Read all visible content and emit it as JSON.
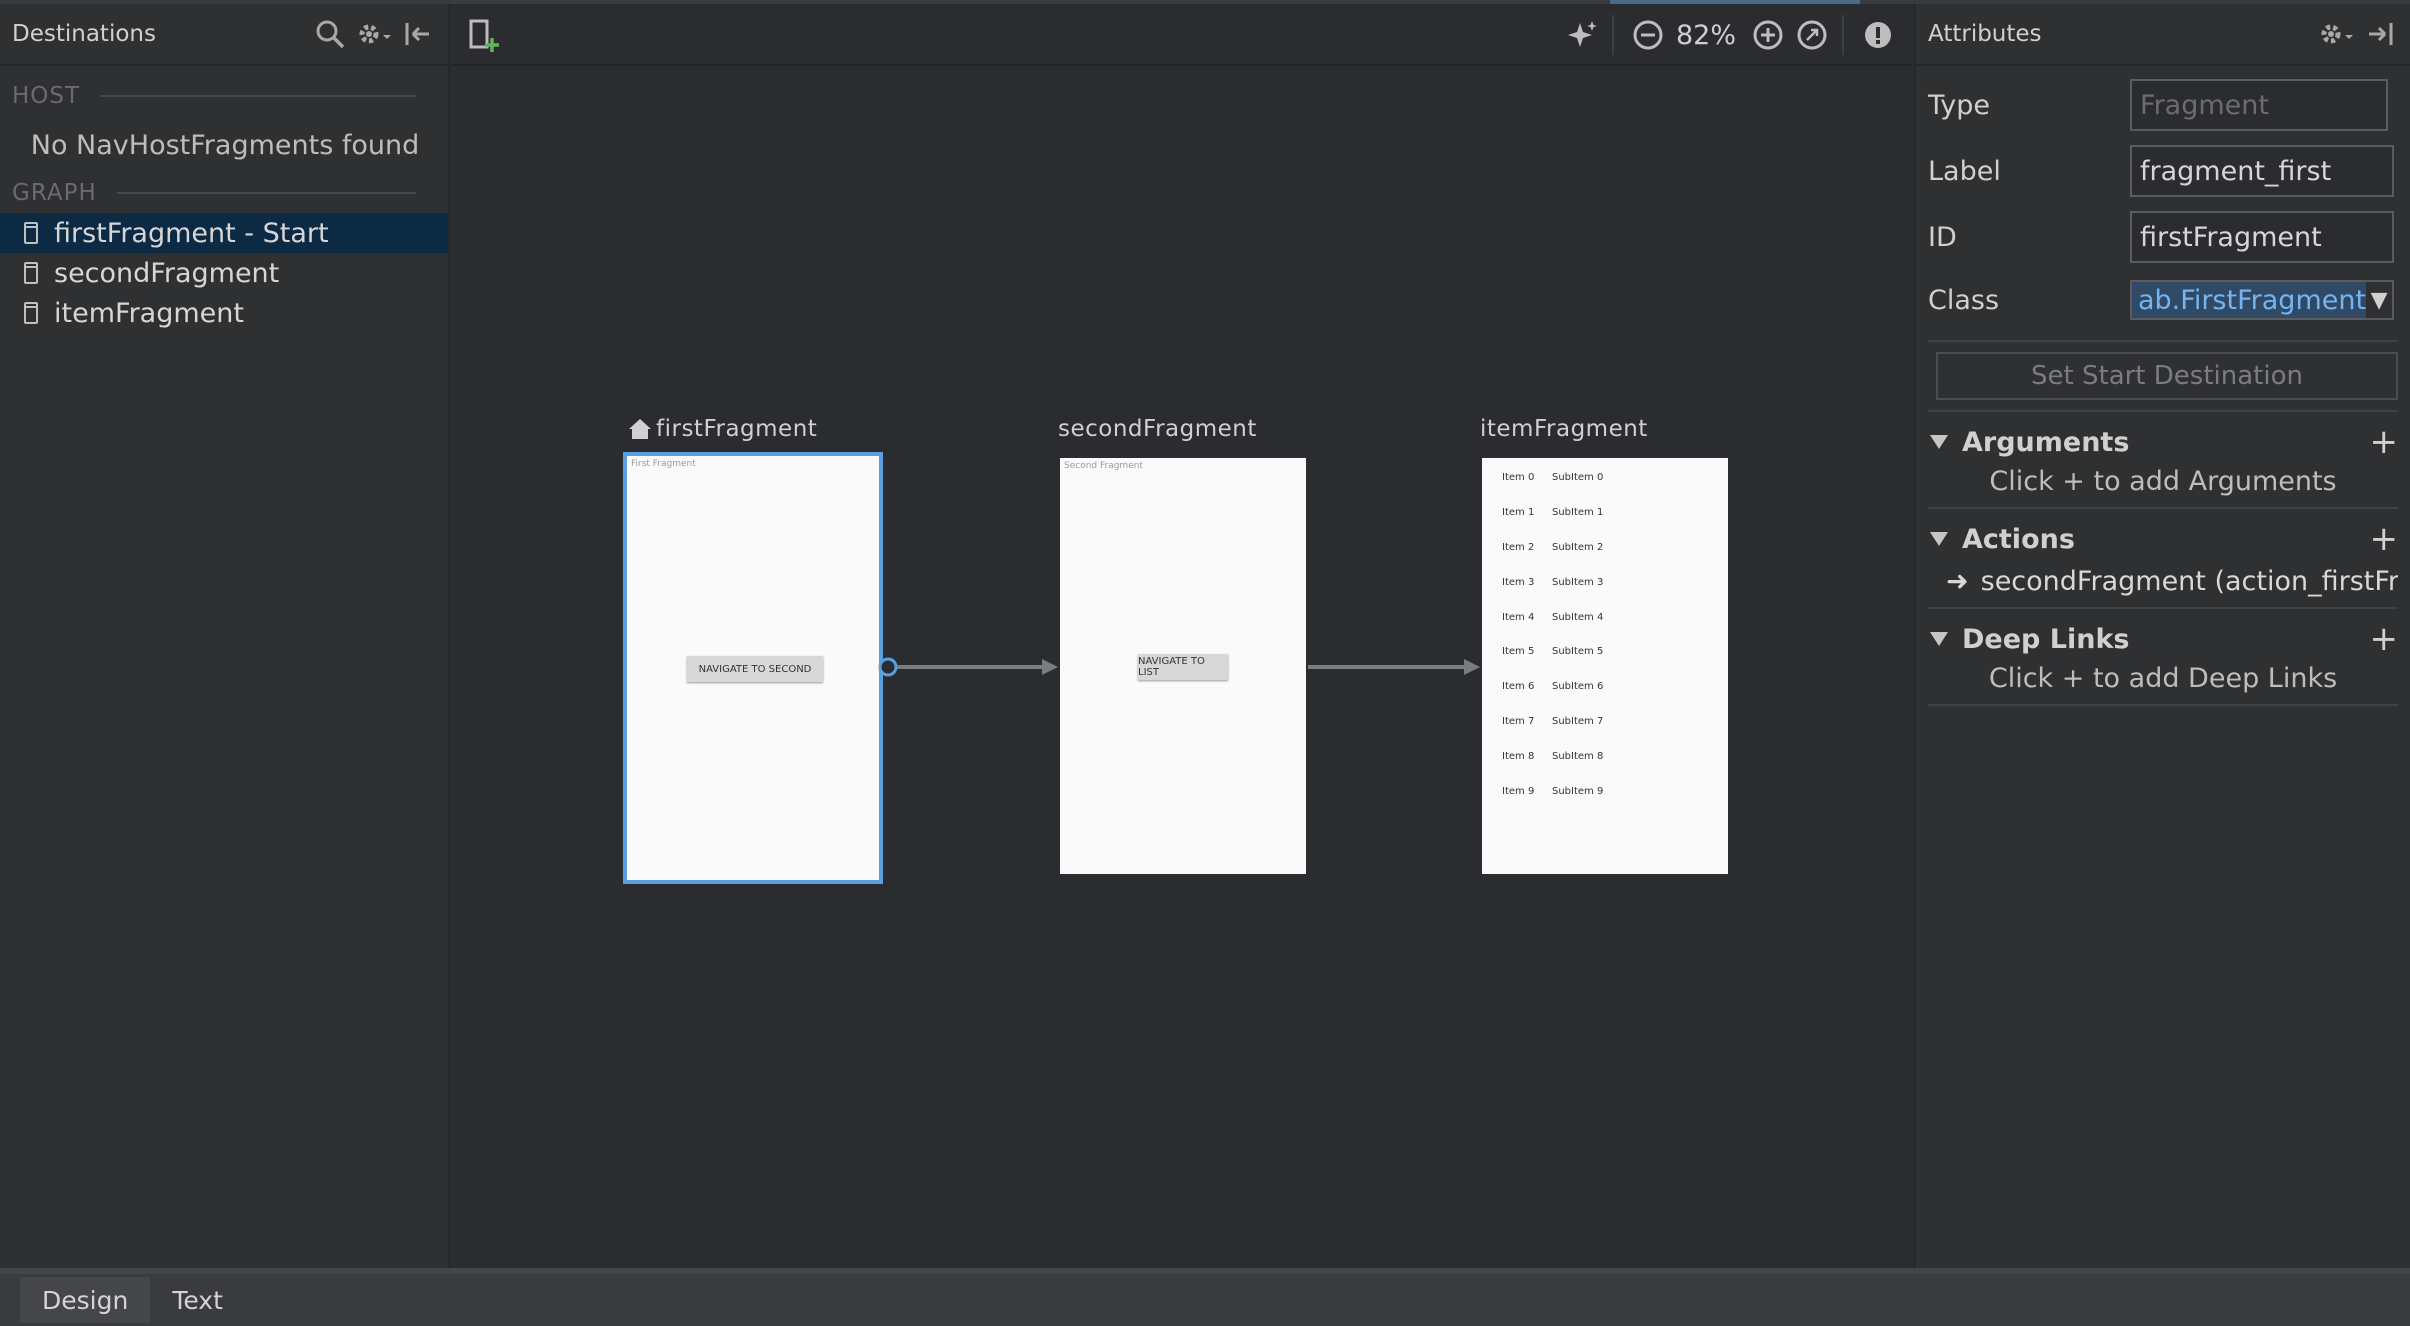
{
  "destinations_panel": {
    "title": "Destinations",
    "host_section": "HOST",
    "host_message": "No NavHostFragments found",
    "graph_section": "GRAPH",
    "items": [
      {
        "label": "firstFragment - Start",
        "selected": true
      },
      {
        "label": "secondFragment",
        "selected": false
      },
      {
        "label": "itemFragment",
        "selected": false
      }
    ]
  },
  "toolbar": {
    "zoom": "82%"
  },
  "graph": {
    "first": {
      "label": "firstFragment",
      "inner_title": "First Fragment",
      "button": "NAVIGATE TO SECOND"
    },
    "second": {
      "label": "secondFragment",
      "inner_title": "Second Fragment",
      "button": "NAVIGATE TO LIST"
    },
    "item": {
      "label": "itemFragment",
      "rows": [
        [
          "Item 0",
          "SubItem 0"
        ],
        [
          "Item 1",
          "SubItem 1"
        ],
        [
          "Item 2",
          "SubItem 2"
        ],
        [
          "Item 3",
          "SubItem 3"
        ],
        [
          "Item 4",
          "SubItem 4"
        ],
        [
          "Item 5",
          "SubItem 5"
        ],
        [
          "Item 6",
          "SubItem 6"
        ],
        [
          "Item 7",
          "SubItem 7"
        ],
        [
          "Item 8",
          "SubItem 8"
        ],
        [
          "Item 9",
          "SubItem 9"
        ]
      ]
    }
  },
  "attributes": {
    "title": "Attributes",
    "type_label": "Type",
    "type_value": "Fragment",
    "label_label": "Label",
    "label_value": "fragment_first",
    "id_label": "ID",
    "id_value": "firstFragment",
    "class_label": "Class",
    "class_value": "ab.FirstFragment",
    "set_start": "Set Start Destination",
    "arguments_title": "Arguments",
    "arguments_msg": "Click + to add Arguments",
    "actions_title": "Actions",
    "action_item": "secondFragment (action_firstFragr",
    "deeplinks_title": "Deep Links",
    "deeplinks_msg": "Click + to add Deep Links"
  },
  "bottom_tabs": {
    "design": "Design",
    "text": "Text"
  },
  "colors": {
    "selection_outline": "#5a9fe0",
    "selected_row": "#0d2a45",
    "class_value_text": "#74b4f0"
  }
}
